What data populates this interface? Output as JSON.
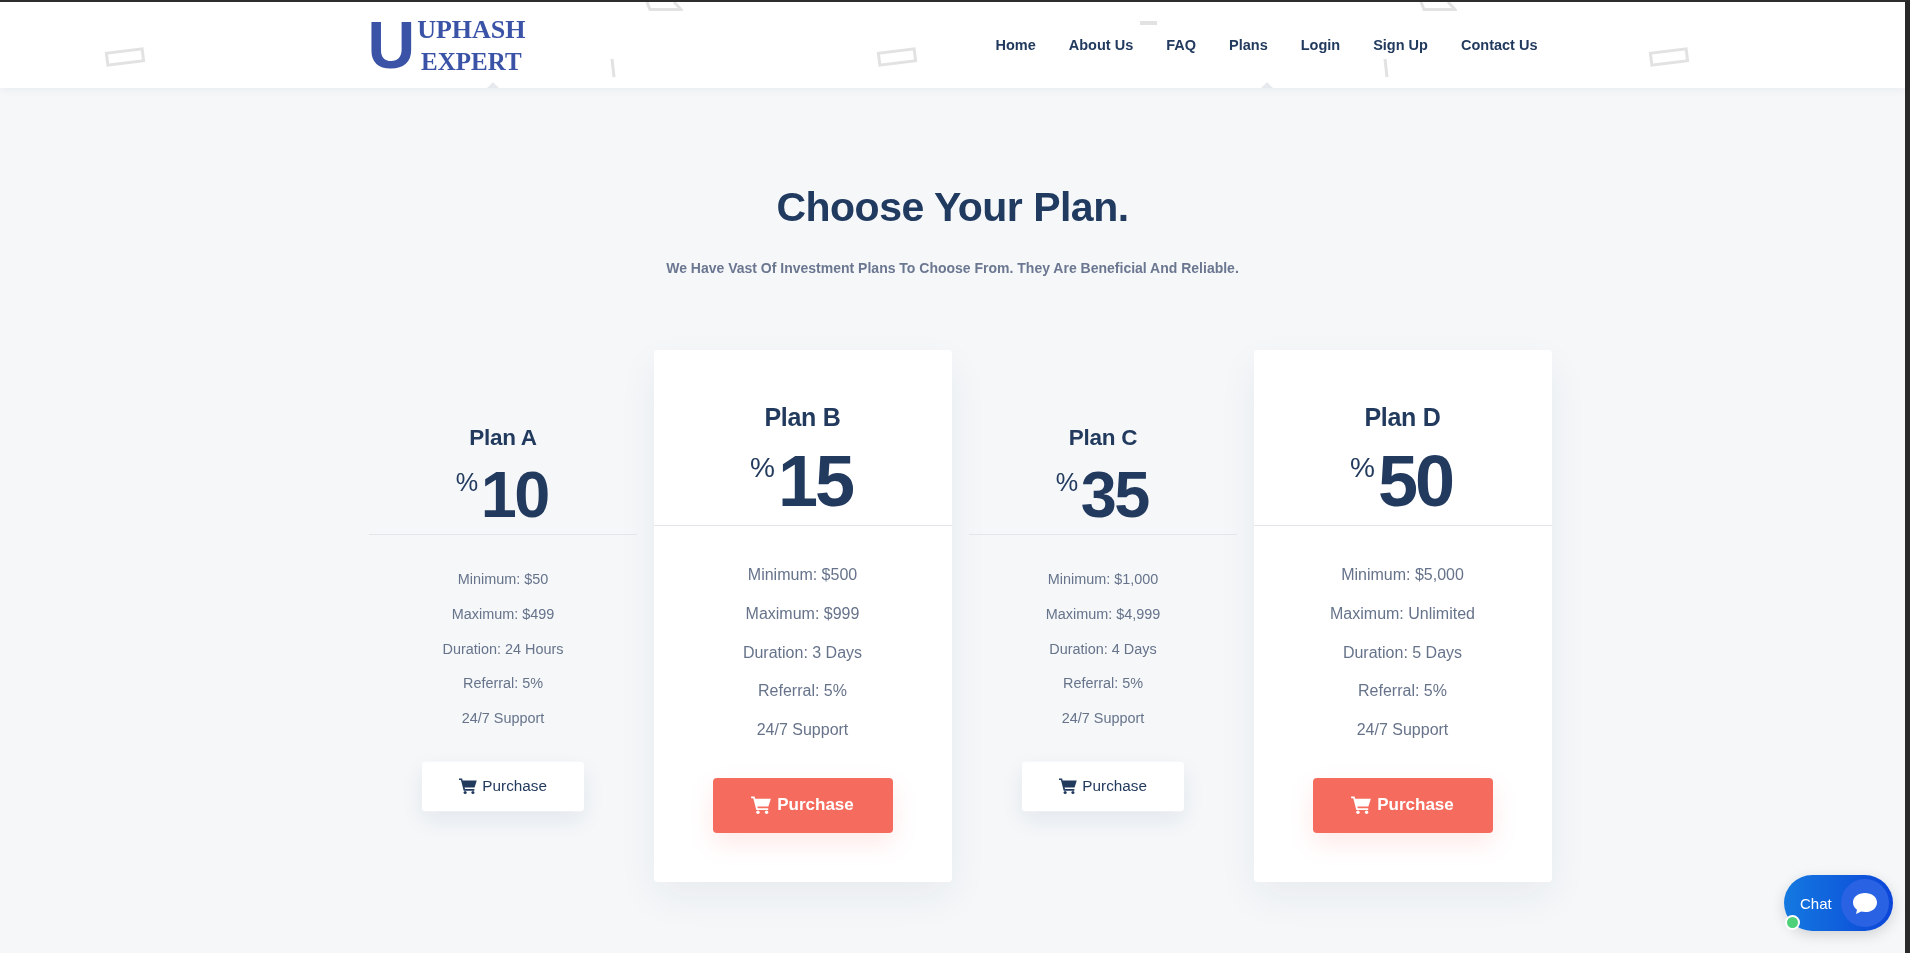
{
  "header": {
    "logo": {
      "letter": "U",
      "lines": [
        "UPHASH",
        "EXPERT"
      ]
    },
    "nav": [
      "Home",
      "About Us",
      "FAQ",
      "Plans",
      "Login",
      "Sign Up",
      "Contact Us"
    ]
  },
  "intro": {
    "title": "Choose Your Plan.",
    "subtitle": "We Have Vast Of Investment Plans To Choose From. They Are Beneficial And Reliable."
  },
  "plans": [
    {
      "name": "Plan A",
      "symbol": "%",
      "rate": "10",
      "featured": false,
      "features": [
        "Minimum: $50",
        "Maximum: $499",
        "Duration: 24 Hours",
        "Referral: 5%",
        "24/7 Support"
      ],
      "button": "Purchase"
    },
    {
      "name": "Plan B",
      "symbol": "%",
      "rate": "15",
      "featured": true,
      "features": [
        "Minimum: $500",
        "Maximum: $999",
        "Duration: 3 Days",
        "Referral: 5%",
        "24/7 Support"
      ],
      "button": "Purchase"
    },
    {
      "name": "Plan C",
      "symbol": "%",
      "rate": "35",
      "featured": false,
      "features": [
        "Minimum: $1,000",
        "Maximum: $4,999",
        "Duration: 4 Days",
        "Referral: 5%",
        "24/7 Support"
      ],
      "button": "Purchase"
    },
    {
      "name": "Plan D",
      "symbol": "%",
      "rate": "50",
      "featured": true,
      "features": [
        "Minimum: $5,000",
        "Maximum: Unlimited",
        "Duration: 5 Days",
        "Referral: 5%",
        "24/7 Support"
      ],
      "button": "Purchase"
    }
  ],
  "chat": {
    "label": "Chat",
    "online": true
  }
}
